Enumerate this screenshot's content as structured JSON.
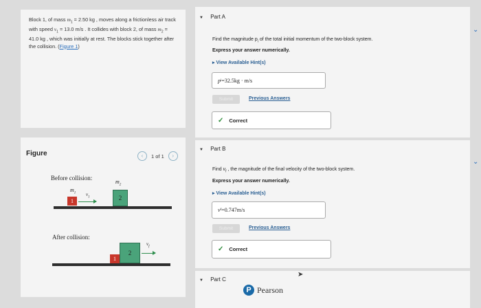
{
  "problem": {
    "prefix": "Block 1, of mass ",
    "m1_sym": "m",
    "m1_sub": "1",
    "m1_val": " = 2.50 kg",
    "t1": " , moves along a frictionless air track with speed ",
    "v1_sym": "v",
    "v1_sub": "1",
    "v1_val": " = 13.0 m/s",
    "t2": " . It collides with block 2, of mass ",
    "m2_sym": "m",
    "m2_sub": "2",
    "m2_val": " = 41.0 kg",
    "t3": " , which was initially at rest. The blocks stick together after the collision. (",
    "figure_link": "Figure 1",
    "t4": ")"
  },
  "figure": {
    "title": "Figure",
    "pager": "1 of 1",
    "before_label": "Before collision:",
    "after_label": "After collision:",
    "m1_label": "m",
    "m1_sub": "1",
    "m2_label": "m",
    "m2_sub": "2",
    "v1_label": "v",
    "v1_sub": "1",
    "vf_label": "v",
    "vf_sub": "f",
    "block1": "1",
    "block2": "2",
    "block1_color": "#c8372b",
    "block2_color": "#4aa37a"
  },
  "partA": {
    "title": "Part A",
    "question": "Find the magnitude p",
    "question_sub": "i",
    "question_rest": " of the total initial momentum of the two-block system.",
    "instruction": "Express your answer numerically.",
    "hint": "View Available Hint(s)",
    "answer_sym": "p",
    "answer_sub": "i",
    "answer_eq": " = ",
    "answer_val": "32.5",
    "answer_unit": " kg · m/s",
    "submit": "Submit",
    "previous": "Previous Answers",
    "status": "Correct"
  },
  "partB": {
    "title": "Part B",
    "question_pre": "Find ",
    "question_sym": "v",
    "question_sub": "f",
    "question_rest": " , the magnitude of the final velocity of the two-block system.",
    "instruction": "Express your answer numerically.",
    "hint": "View Available Hint(s)",
    "answer_sym": "v",
    "answer_sub": "f",
    "answer_eq": " = ",
    "answer_val": "0.747",
    "answer_unit": " m/s",
    "submit": "Submit",
    "previous": "Previous Answers",
    "status": "Correct"
  },
  "partC": {
    "title": "Part C"
  },
  "brand": {
    "name": "Pearson",
    "logo_letter": "P",
    "color": "#1a6aa8"
  }
}
